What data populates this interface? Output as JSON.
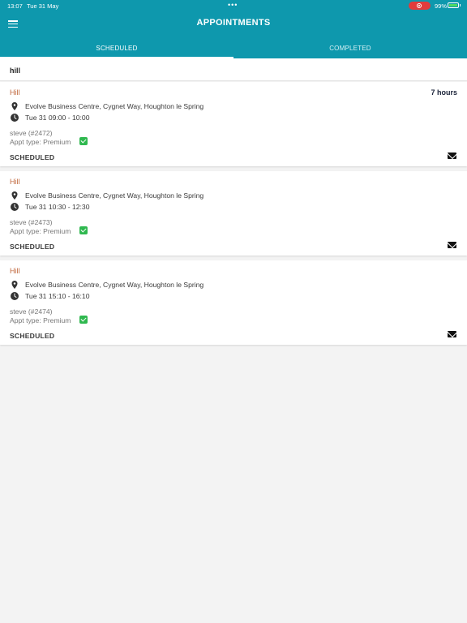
{
  "status_bar": {
    "time": "13:07",
    "date": "Tue 31 May",
    "dots": "•••",
    "battery": "99%",
    "record_icon": "record-icon",
    "battery_icon": "battery-charging-icon"
  },
  "header": {
    "title": "APPOINTMENTS",
    "menu_icon": "hamburger-menu-icon",
    "background": "#0e98ad"
  },
  "tabs": [
    {
      "label": "SCHEDULED",
      "active": true
    },
    {
      "label": "COMPLETED",
      "active": false
    }
  ],
  "filter": {
    "text": "hill"
  },
  "appointments": [
    {
      "title": "Hill",
      "badge": "7 hours",
      "address": "Evolve Business Centre, Cygnet Way, Houghton le Spring",
      "time": "Tue 31 09:00 - 10:00",
      "customer": "steve (#2472)",
      "appt_type": "Appt type: Premium",
      "status": "SCHEDULED"
    },
    {
      "title": "Hill",
      "badge": "",
      "address": "Evolve Business Centre, Cygnet Way, Houghton le Spring",
      "time": "Tue 31 10:30 - 12:30",
      "customer": "steve (#2473)",
      "appt_type": "Appt type: Premium",
      "status": "SCHEDULED"
    },
    {
      "title": "Hill",
      "badge": "",
      "address": "Evolve Business Centre, Cygnet Way, Houghton le Spring",
      "time": "Tue 31 15:10 - 16:10",
      "customer": "steve (#2474)",
      "appt_type": "Appt type: Premium",
      "status": "SCHEDULED"
    }
  ],
  "colors": {
    "accent": "#0e98ad",
    "title": "#c0653a",
    "check": "#2fb84f"
  }
}
